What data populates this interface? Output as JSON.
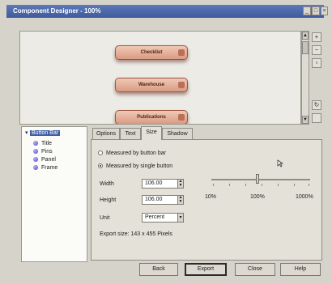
{
  "window": {
    "title": "Component Designer - 100%"
  },
  "preview": {
    "buttons": [
      {
        "label": "Checklist"
      },
      {
        "label": "Warehouse"
      },
      {
        "label": "Publications"
      }
    ]
  },
  "tree": {
    "root": "Button Bar",
    "items": [
      {
        "label": "Title"
      },
      {
        "label": "Pins"
      },
      {
        "label": "Panel"
      },
      {
        "label": "Frame"
      }
    ]
  },
  "tabs": [
    {
      "label": "Options"
    },
    {
      "label": "Text"
    },
    {
      "label": "Size",
      "active": true
    },
    {
      "label": "Shadow"
    }
  ],
  "size": {
    "radio_bar": "Measured by button bar",
    "radio_single": "Measured by single button",
    "selected": "single",
    "width_label": "Width",
    "width_value": "106.00",
    "height_label": "Height",
    "height_value": "106.00",
    "unit_label": "Unit",
    "unit_value": "Percent",
    "export_size": "Export size: 143 x 455 Pixels",
    "slider": {
      "min_label": "10%",
      "mid_label": "100%",
      "max_label": "1000%",
      "value_percent": 106
    }
  },
  "footer": {
    "back": "Back",
    "export": "Export",
    "close": "Close",
    "help": "Help"
  },
  "colors": {
    "title_bar": "#4a66a8",
    "button_face": "#e0b09c",
    "selection": "#3f5fa7"
  }
}
